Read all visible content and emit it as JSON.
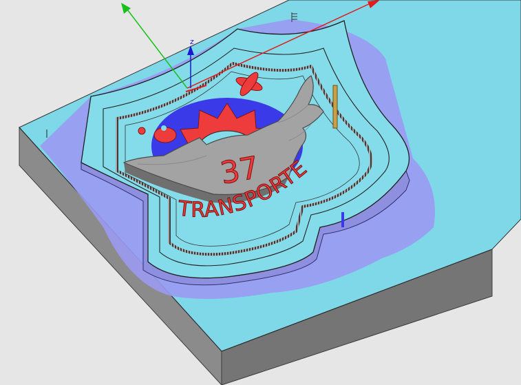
{
  "viewport": {
    "background": "#e6e6e6",
    "material_color": "#7fd8e8",
    "shadow_color": "#9a9af2",
    "highlight_color": "#ee3c3c",
    "wing_color": "#a3a3a3"
  },
  "axes": {
    "z_label": "z",
    "x_color": "#e01b1b",
    "y_color": "#19c019",
    "z_color": "#1a1acc"
  },
  "part": {
    "number_text": "37",
    "curved_text": "TRANSPORTE"
  },
  "icons": {
    "corner_marker": "corner-marker-icon",
    "tool": "tool-icon"
  }
}
